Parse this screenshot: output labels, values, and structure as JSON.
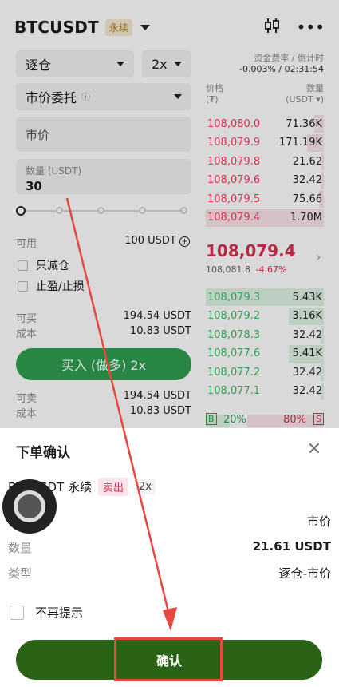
{
  "header": {
    "pair": "BTCUSDT",
    "tag": "永续",
    "chart_icon": "candlestick-icon",
    "more_icon": "more-icon"
  },
  "form": {
    "margin_mode": "逐仓",
    "leverage": "2x",
    "order_type": "市价委托",
    "price_placeholder": "市价",
    "qty_label": "数量 (USDT)",
    "qty_value": "30",
    "slider_percent": 0,
    "available_label": "可用",
    "available_value": "100 USDT",
    "reduce_only": "只减仓",
    "tp_sl": "止盈/止损",
    "buy_can_label": "可买",
    "buy_can_value": "194.54 USDT",
    "cost_label": "成本",
    "cost_value": "10.83 USDT",
    "buy_button": "买入 (做多) 2x",
    "sell_can_label": "可卖",
    "sell_can_value": "194.54 USDT",
    "sell_cost_label": "成本",
    "sell_cost_value": "10.83 USDT"
  },
  "orderbook": {
    "funding_label": "资金费率 / 倒计时",
    "funding_value": "-0.003% / 02:31:54",
    "price_header": "价格",
    "price_unit": "(₮)",
    "qty_header": "数量",
    "qty_unit": "(USDT ▾)",
    "asks": [
      {
        "price": "108,080.0",
        "qty": "71.36K"
      },
      {
        "price": "108,079.9",
        "qty": "171.19K"
      },
      {
        "price": "108,079.8",
        "qty": "21.62"
      },
      {
        "price": "108,079.6",
        "qty": "32.42"
      },
      {
        "price": "108,079.5",
        "qty": "75.66"
      },
      {
        "price": "108,079.4",
        "qty": "1.70M"
      }
    ],
    "last_price": "108,079.4",
    "mark_price": "108,081.8",
    "change": "-4.67%",
    "bids": [
      {
        "price": "108,079.3",
        "qty": "5.43K"
      },
      {
        "price": "108,079.2",
        "qty": "3.16K"
      },
      {
        "price": "108,078.3",
        "qty": "32.42"
      },
      {
        "price": "108,077.6",
        "qty": "5.41K"
      },
      {
        "price": "108,077.2",
        "qty": "32.42"
      },
      {
        "price": "108,077.1",
        "qty": "32.42"
      }
    ],
    "buy_letter": "B",
    "buy_ratio": "20%",
    "sell_ratio": "80%",
    "sell_letter": "S"
  },
  "sheet": {
    "title": "下单确认",
    "product": "BTCUSDT 永续",
    "side": "卖出",
    "leverage": "2x",
    "rows": [
      {
        "label": "价格",
        "value": "市价"
      },
      {
        "label": "数量",
        "value": "21.61 USDT"
      },
      {
        "label": "类型",
        "value": "逐仓-市价"
      }
    ],
    "no_prompt": "不再提示",
    "confirm": "确认"
  },
  "colors": {
    "buy": "#2e9e4f",
    "sell": "#d9304f",
    "confirm": "#2b6316",
    "highlight": "#e8473e"
  }
}
